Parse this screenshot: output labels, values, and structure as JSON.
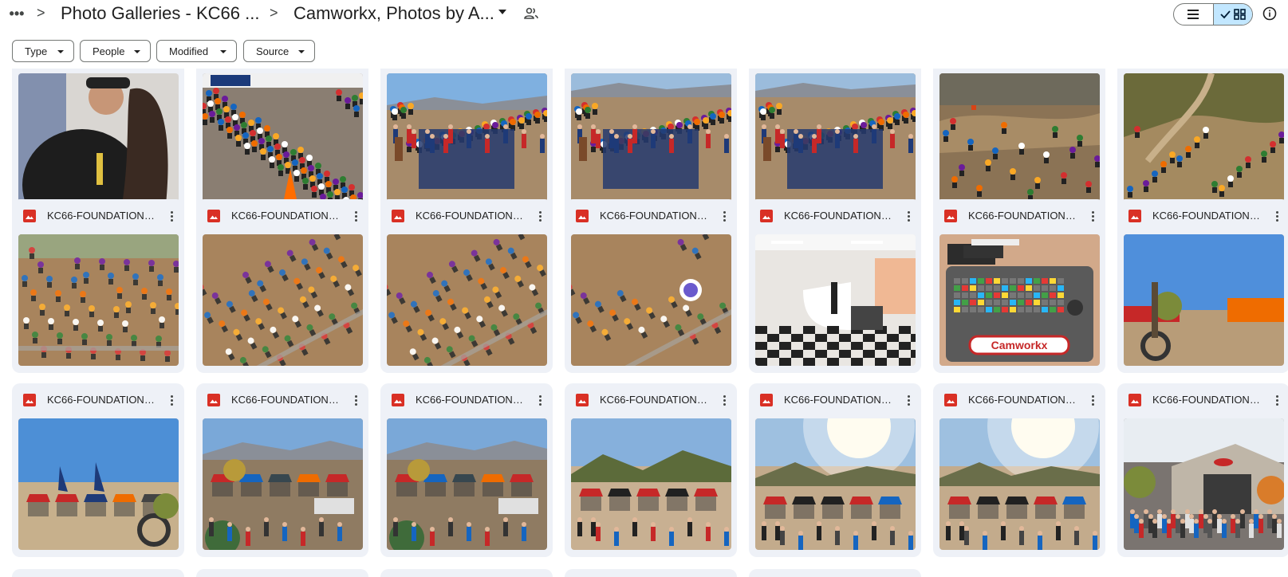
{
  "header": {
    "more_label": "•••",
    "breadcrumb": [
      "Photo Galleries - KC66 ...",
      "Camworkx, Photos by A..."
    ],
    "separator": ">"
  },
  "filters": [
    "Type",
    "People",
    "Modified",
    "Source"
  ],
  "file_name": "KC66-FOUNDATION-...",
  "colors": {
    "accent": "#c2e7ff",
    "card_bg": "#eef1f7",
    "image_icon": "#d93025"
  },
  "rows": [
    {
      "has_title": false,
      "items": [
        "portrait",
        "crowd-bikes",
        "group-sky",
        "group-hills",
        "group-hills",
        "track-hill",
        "hillside"
      ]
    },
    {
      "has_title": true,
      "items": [
        "start-gate",
        "start-gate-tilt",
        "start-gate-tilt",
        "start-gate-close",
        "studio",
        "keyboard-camworkx",
        "pits-sky"
      ]
    },
    {
      "has_title": true,
      "items": [
        "pits-flags",
        "pits-aerial",
        "pits-aerial",
        "pits-mountains",
        "pits-sun",
        "pits-sun",
        "crowd-building"
      ]
    }
  ],
  "keyboard_brand": "Camworkx"
}
